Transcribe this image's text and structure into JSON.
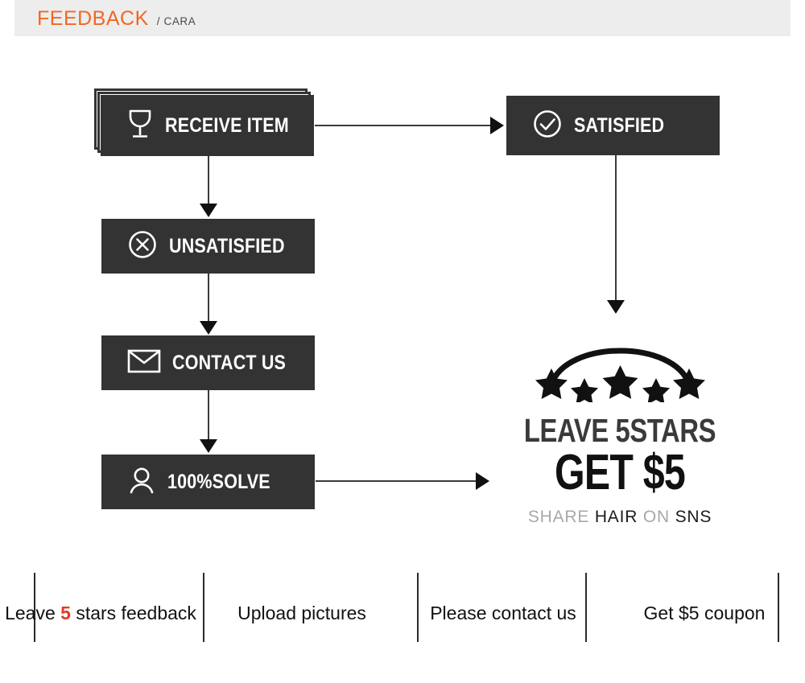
{
  "header": {
    "title": "FEEDBACK",
    "subtitle": "/ CARA",
    "title_color": "#F26722",
    "band_color": "#EDEDED"
  },
  "flow": {
    "node_fill": "#333333",
    "node_text_color": "#FFFFFF",
    "nodes": [
      {
        "id": "receive",
        "label": "RECEIVE ITEM",
        "icon": "wine-glass-icon",
        "stacked": true
      },
      {
        "id": "satisfied",
        "label": "SATISFIED",
        "icon": "check-circle-icon",
        "stacked": false
      },
      {
        "id": "unsatisfied",
        "label": "UNSATISFIED",
        "icon": "x-circle-icon",
        "stacked": false
      },
      {
        "id": "contact",
        "label": "CONTACT US",
        "icon": "envelope-icon",
        "stacked": false
      },
      {
        "id": "solve",
        "label": "100%SOLVE",
        "icon": "person-icon",
        "stacked": false
      }
    ],
    "connectors": [
      {
        "from": "receive",
        "to": "satisfied",
        "direction": "right"
      },
      {
        "from": "receive",
        "to": "unsatisfied",
        "direction": "down"
      },
      {
        "from": "unsatisfied",
        "to": "contact",
        "direction": "down"
      },
      {
        "from": "contact",
        "to": "solve",
        "direction": "down"
      },
      {
        "from": "satisfied",
        "to": "promo",
        "direction": "down"
      },
      {
        "from": "solve",
        "to": "promo",
        "direction": "right"
      }
    ]
  },
  "promo": {
    "stars_count": 5,
    "stars_icon": "five-stars-arc-icon",
    "line1": "LEAVE 5STARS",
    "line2": "GET $5",
    "line3": [
      {
        "text": "SHARE",
        "tone": "soft"
      },
      {
        "text": "HAIR",
        "tone": "hard"
      },
      {
        "text": "ON",
        "tone": "soft"
      },
      {
        "text": "SNS",
        "tone": "hard"
      }
    ]
  },
  "bottom": {
    "accent_color": "#E03B24",
    "cells": [
      {
        "pre": "Leave ",
        "accent": "5",
        "post": " stars feedback"
      },
      {
        "pre": "Upload pictures",
        "accent": "",
        "post": ""
      },
      {
        "pre": "Please contact us",
        "accent": "",
        "post": ""
      },
      {
        "pre": "Get $5 coupon",
        "accent": "",
        "post": ""
      }
    ]
  }
}
